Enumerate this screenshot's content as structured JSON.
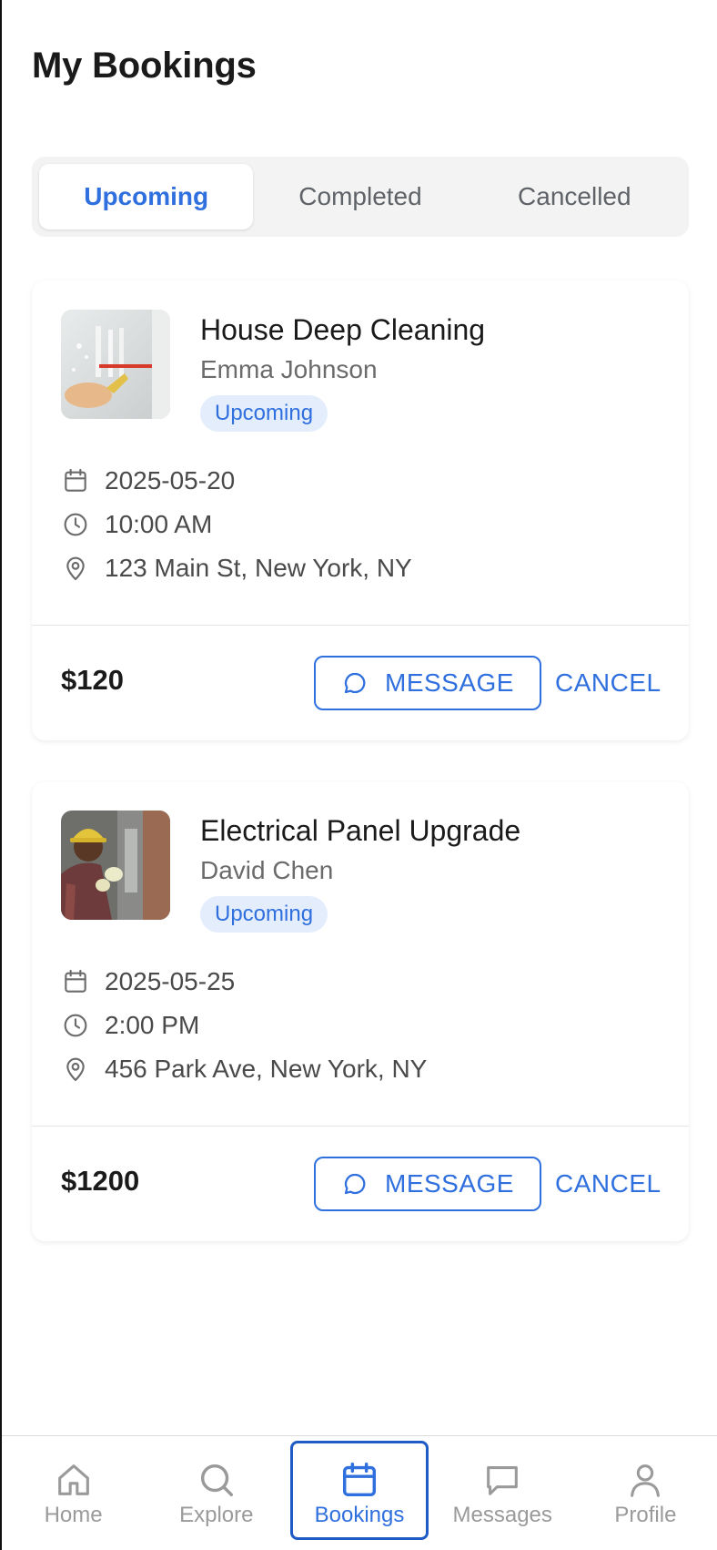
{
  "header": {
    "title": "My Bookings"
  },
  "tabs": [
    {
      "label": "Upcoming",
      "active": true
    },
    {
      "label": "Completed",
      "active": false
    },
    {
      "label": "Cancelled",
      "active": false
    }
  ],
  "bookings": [
    {
      "service": "House Deep Cleaning",
      "provider": "Emma Johnson",
      "status": "Upcoming",
      "date": "2025-05-20",
      "time": "10:00 AM",
      "address": "123 Main St, New York, NY",
      "price": "$120",
      "message_label": "MESSAGE",
      "cancel_label": "CANCEL",
      "image": "cleaning-photo"
    },
    {
      "service": "Electrical Panel Upgrade",
      "provider": "David Chen",
      "status": "Upcoming",
      "date": "2025-05-25",
      "time": "2:00 PM",
      "address": "456 Park Ave, New York, NY",
      "price": "$1200",
      "message_label": "MESSAGE",
      "cancel_label": "CANCEL",
      "image": "electrician-photo"
    }
  ],
  "nav": [
    {
      "label": "Home",
      "icon": "home-icon",
      "active": false
    },
    {
      "label": "Explore",
      "icon": "search-icon",
      "active": false
    },
    {
      "label": "Bookings",
      "icon": "calendar-icon",
      "active": true
    },
    {
      "label": "Messages",
      "icon": "chat-icon",
      "active": false
    },
    {
      "label": "Profile",
      "icon": "person-icon",
      "active": false
    }
  ],
  "colors": {
    "accent": "#2f6fde",
    "badge_bg": "#e3edfc",
    "muted_text": "#6b6b6b",
    "nav_inactive": "#9a9a9a"
  }
}
